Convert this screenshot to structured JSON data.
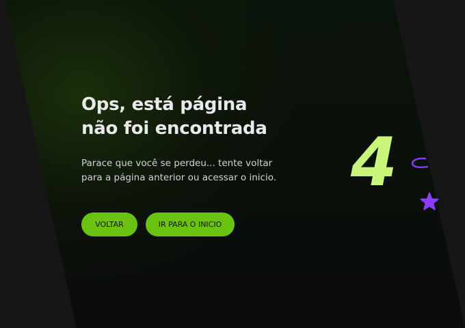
{
  "headline": {
    "line1": "Ops, está página",
    "line2": "não foi encontrada"
  },
  "description": {
    "line1": "Parace que você se perdeu... tente voltar",
    "line2": "para a página anterior ou acessar o inicio."
  },
  "buttons": {
    "back_label": "VOLTAR",
    "home_label": "IR PARA O INICIO"
  },
  "illustration": {
    "digit": "4",
    "icons": [
      "arc-icon",
      "star-icon"
    ]
  },
  "colors": {
    "accent_green": "#6cc210",
    "digit_green": "#c9f57a",
    "purple": "#8b3dff",
    "background": "#161616",
    "panel": "#0a0f0a"
  }
}
